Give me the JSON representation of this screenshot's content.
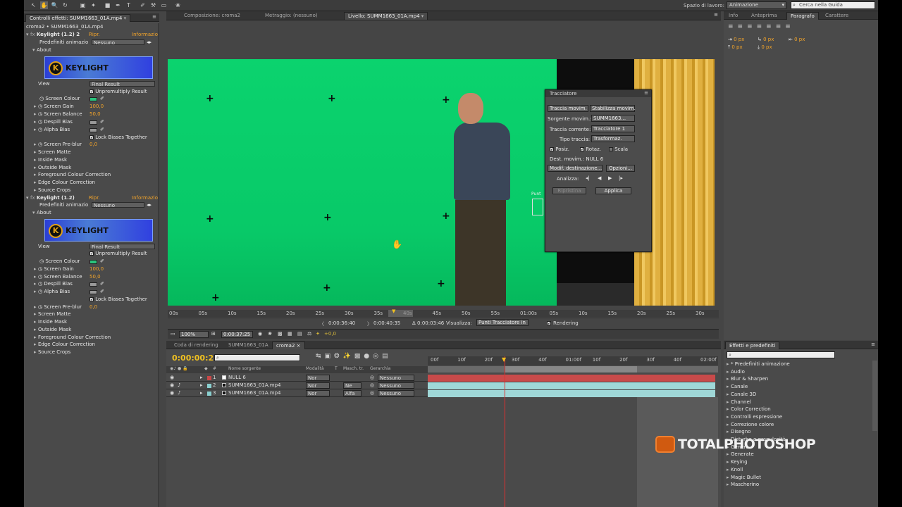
{
  "toolbar": {
    "tools": [
      "selection-tool",
      "hand-tool",
      "zoom-tool",
      "rotate-tool",
      "camera-tool",
      "pan-behind-tool",
      "rectangle-tool",
      "pen-tool",
      "text-tool",
      "brush-tool",
      "clone-tool",
      "eraser-tool",
      "puppet-tool"
    ],
    "workspace_label": "Spazio di lavoro:",
    "workspace_value": "Animazione",
    "search_placeholder": "Cerca nella Guida"
  },
  "effects_panel": {
    "tab": "Controlli effetti: SUMM1663_01A.mp4",
    "breadcrumb": "croma2 • SUMM1663_01A.mp4",
    "effect1": {
      "name": "Keylight (1.2) 2",
      "reset": "Ripr.",
      "about_link": "Informazio",
      "presets_label": "Predefiniti animazio",
      "presets_value": "Nessuno",
      "about": "About",
      "logo": "KEYLIGHT",
      "view_label": "View",
      "view_value": "Final Result",
      "unpremultiply": "Unpremultiply Result",
      "screen_colour": "Screen Colour",
      "screen_gain": "Screen Gain",
      "screen_gain_value": "100,0",
      "screen_balance": "Screen Balance",
      "screen_balance_value": "50,0",
      "despill_bias": "Despill Bias",
      "alpha_bias": "Alpha Bias",
      "lock_biases": "Lock Biases Together",
      "screen_preblur": "Screen Pre-blur",
      "screen_preblur_value": "0,0",
      "groups": [
        "Screen Matte",
        "Inside Mask",
        "Outside Mask",
        "Foreground Colour Correction",
        "Edge Colour Correction",
        "Source Crops"
      ]
    },
    "effect2": {
      "name": "Keylight (1.2)",
      "reset": "Ripr.",
      "about_link": "Informazio",
      "presets_label": "Predefiniti animazio",
      "presets_value": "Nessuno",
      "about": "About",
      "logo": "KEYLIGHT",
      "view_label": "View",
      "view_value": "Final Result",
      "unpremultiply": "Unpremultiply Result",
      "screen_colour": "Screen Colour",
      "screen_gain": "Screen Gain",
      "screen_gain_value": "100,0",
      "screen_balance": "Screen Balance",
      "screen_balance_value": "50,0",
      "despill_bias": "Despill Bias",
      "alpha_bias": "Alpha Bias",
      "lock_biases": "Lock Biases Together",
      "screen_preblur": "Screen Pre-blur",
      "screen_preblur_value": "0,0",
      "groups": [
        "Screen Matte",
        "Inside Mask",
        "Outside Mask",
        "Foreground Colour Correction",
        "Edge Colour Correction",
        "Source Crops"
      ]
    }
  },
  "viewer": {
    "tabs": [
      "Composizione: croma2",
      "Metraggio: (nessuno)",
      "Livello: SUMM1663_01A.mp4"
    ],
    "ruler_ticks": [
      "00s",
      "05s",
      "10s",
      "15s",
      "20s",
      "25s",
      "30s",
      "35s",
      "40s",
      "45s",
      "50s",
      "55s",
      "01:00s",
      "05s",
      "10s",
      "15s",
      "20s",
      "25s",
      "30s"
    ],
    "in_time": "0:00:36:40",
    "out_time": "0:00:40:35",
    "duration": "Δ 0:00:03:46",
    "view_label": "Visualizza:",
    "view_value": "Punti Tracciatore in",
    "rendering": "Rendering",
    "zoom": "100%",
    "current_time": "0:00:37:25",
    "exposure": "+0,0",
    "partial_label": "Punt"
  },
  "tracker": {
    "title": "Tracciatore",
    "track_motion": "Traccia movim.",
    "stabilize_motion": "Stabilizza movim.",
    "source_label": "Sorgente movim.:",
    "source_value": "SUMM1663...",
    "current_label": "Traccia corrente:",
    "current_value": "Tracciatore 1",
    "type_label": "Tipo traccia:",
    "type_value": "Trasformaz.",
    "position": "Posiz.",
    "rotation": "Rotaz.",
    "scale": "Scala",
    "target_label": "Dest. movim.:",
    "target_value": "NULL 6",
    "edit_target": "Modif. destinazione...",
    "options": "Opzioni...",
    "analyze_label": "Analizza:",
    "reset": "Ripristina",
    "apply": "Applica"
  },
  "right_panel": {
    "tabs": [
      "Info",
      "Anteprima",
      "Paragrafo",
      "Carattere"
    ],
    "indent_values": [
      "0 px",
      "0 px",
      "0 px",
      "0 px",
      "0 px"
    ]
  },
  "timeline": {
    "tabs": [
      "Coda di rendering",
      "SUMM1663_01A",
      "croma2"
    ],
    "timecode": "0:00:00:28",
    "columns": [
      "Nome sorgente",
      "Modalità",
      "T",
      "Masch. tr.",
      "Gerarchia"
    ],
    "layers": [
      {
        "num": "1",
        "name": "NULL 6",
        "mode": "Nor",
        "track": "",
        "parent": "Nessuno",
        "color": "#c94848",
        "bar": "#c84a4a"
      },
      {
        "num": "2",
        "name": "SUMM1663_01A.mp4",
        "mode": "Nor",
        "track": "Ne",
        "parent": "Nessuno",
        "color": "#8ad0d0",
        "bar": "#9fd7d7"
      },
      {
        "num": "3",
        "name": "SUMM1663_01A.mp4",
        "mode": "Nor",
        "track": "Alfa",
        "parent": "Nessuno",
        "color": "#8ad0d0",
        "bar": "#9fd7d7"
      }
    ],
    "ruler_ticks": [
      "00f",
      "10f",
      "20f",
      "30f",
      "40f",
      "01:00f",
      "10f",
      "20f",
      "30f",
      "40f",
      "02:00f"
    ]
  },
  "effects_presets": {
    "tab": "Effetti e predefiniti",
    "items": [
      "* Predefiniti animazione",
      "Audio",
      "Blur & Sharpen",
      "Canale",
      "Canale 3D",
      "Channel",
      "Color Correction",
      "Controlli espressione",
      "Correzione colore",
      "Disegno",
      "Disturbo e granulosità",
      "Genera",
      "Generate",
      "Keying",
      "Knoll",
      "Magic Bullet",
      "Mascherino"
    ]
  },
  "watermark": {
    "text": "TOTALPHOTOSHOP"
  },
  "colors": {
    "accent_orange": "#f3a42a",
    "timecode_yellow": "#f0c020",
    "playhead": "#e03030"
  }
}
